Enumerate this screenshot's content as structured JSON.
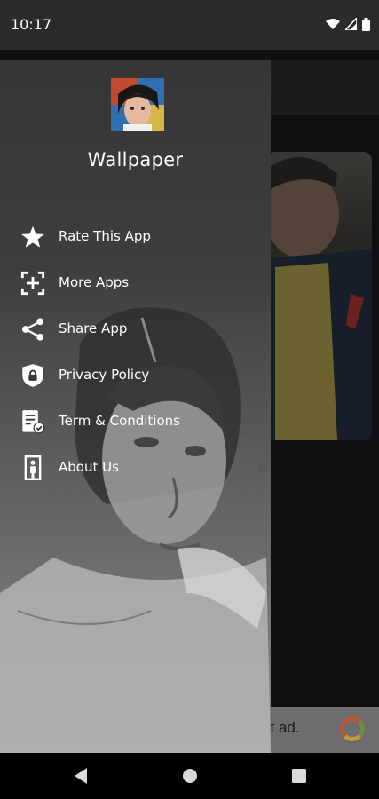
{
  "status_bar": {
    "time": "10:17"
  },
  "drawer": {
    "app_name": "Wallpaper",
    "items": [
      {
        "label": "Rate This App",
        "icon": "star-icon"
      },
      {
        "label": "More Apps",
        "icon": "apps-scan-icon"
      },
      {
        "label": "Share App",
        "icon": "share-icon"
      },
      {
        "label": "Privacy Policy",
        "icon": "shield-lock-icon"
      },
      {
        "label": "Term & Conditions",
        "icon": "document-check-icon"
      },
      {
        "label": "About Us",
        "icon": "person-door-icon"
      }
    ]
  },
  "ad_banner": {
    "text": "st ad."
  },
  "colors": {
    "drawer_bg": "#363636",
    "status_bar": "#2b2b2b",
    "text": "#ffffff"
  }
}
